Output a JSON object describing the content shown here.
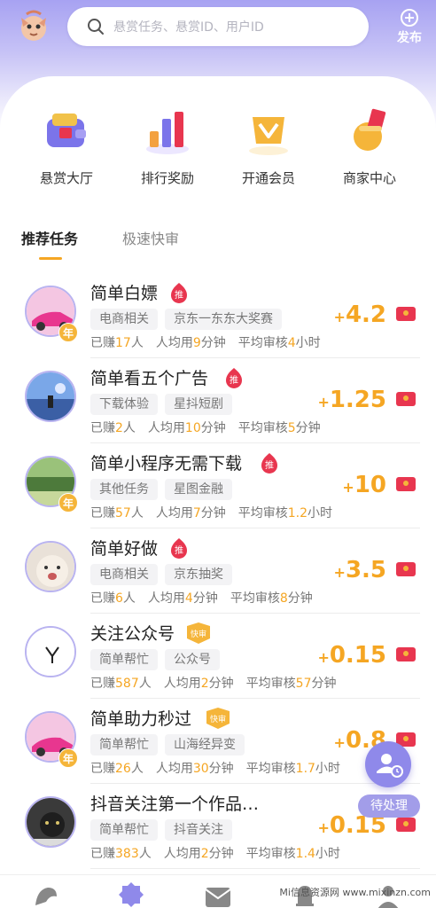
{
  "header": {
    "search_placeholder": "悬赏任务、悬赏ID、用户ID",
    "publish_label": "发布"
  },
  "quick_menu": [
    {
      "label": "悬赏大厅",
      "icon": "wallet-icon"
    },
    {
      "label": "排行奖励",
      "icon": "ranking-icon"
    },
    {
      "label": "开通会员",
      "icon": "vip-icon"
    },
    {
      "label": "商家中心",
      "icon": "merchant-icon"
    }
  ],
  "tabs": [
    "推荐任务",
    "极速快审"
  ],
  "tasks": [
    {
      "title": "简单白嫖",
      "badge": "推",
      "tags": [
        "电商相关",
        "京东一东东大奖赛"
      ],
      "earned_prefix": "已赚",
      "earned": "17",
      "earned_unit": "人",
      "avg_prefix": "人均用",
      "avg": "9",
      "avg_unit": "分钟",
      "review_prefix": "平均审核",
      "review": "4",
      "review_unit": "小时",
      "reward": "4.2",
      "year": "年"
    },
    {
      "title": "简单看五个广告",
      "badge": "推",
      "tags": [
        "下载体验",
        "星抖短剧"
      ],
      "earned_prefix": "已赚",
      "earned": "2",
      "earned_unit": "人",
      "avg_prefix": "人均用",
      "avg": "10",
      "avg_unit": "分钟",
      "review_prefix": "平均审核",
      "review": "5",
      "review_unit": "分钟",
      "reward": "1.25",
      "year": ""
    },
    {
      "title": "简单小程序无需下载",
      "badge": "推",
      "tags": [
        "其他任务",
        "星图金融"
      ],
      "earned_prefix": "已赚",
      "earned": "57",
      "earned_unit": "人",
      "avg_prefix": "人均用",
      "avg": "7",
      "avg_unit": "分钟",
      "review_prefix": "平均审核",
      "review": "1.2",
      "review_unit": "小时",
      "reward": "10",
      "year": "年"
    },
    {
      "title": "简单好做",
      "badge": "推",
      "tags": [
        "电商相关",
        "京东抽奖"
      ],
      "earned_prefix": "已赚",
      "earned": "6",
      "earned_unit": "人",
      "avg_prefix": "人均用",
      "avg": "4",
      "avg_unit": "分钟",
      "review_prefix": "平均审核",
      "review": "8",
      "review_unit": "分钟",
      "reward": "3.5",
      "year": ""
    },
    {
      "title": "关注公众号",
      "badge": "快审",
      "tags": [
        "简单帮忙",
        "公众号"
      ],
      "earned_prefix": "已赚",
      "earned": "587",
      "earned_unit": "人",
      "avg_prefix": "人均用",
      "avg": "2",
      "avg_unit": "分钟",
      "review_prefix": "平均审核",
      "review": "57",
      "review_unit": "分钟",
      "reward": "0.15",
      "year": ""
    },
    {
      "title": "简单助力秒过",
      "badge": "快审",
      "tags": [
        "简单帮忙",
        "山海经异变"
      ],
      "earned_prefix": "已赚",
      "earned": "26",
      "earned_unit": "人",
      "avg_prefix": "人均用",
      "avg": "30",
      "avg_unit": "分钟",
      "review_prefix": "平均审核",
      "review": "1.7",
      "review_unit": "小时",
      "reward": "0.8",
      "year": "年"
    },
    {
      "title": "抖音关注第一个作品…",
      "badge": "",
      "tags": [
        "简单帮忙",
        "抖音关注"
      ],
      "earned_prefix": "已赚",
      "earned": "383",
      "earned_unit": "人",
      "avg_prefix": "人均用",
      "avg": "2",
      "avg_unit": "分钟",
      "review_prefix": "平均审核",
      "review": "1.4",
      "review_unit": "小时",
      "reward": "0.15",
      "year": ""
    }
  ],
  "floating": {
    "pending_label": "待处理"
  },
  "watermark": "Mi信息资源网 www.mixinzn.com",
  "colors": {
    "accent": "#f5a623",
    "brand": "#8f89ea",
    "badge_red": "#e8364f"
  }
}
